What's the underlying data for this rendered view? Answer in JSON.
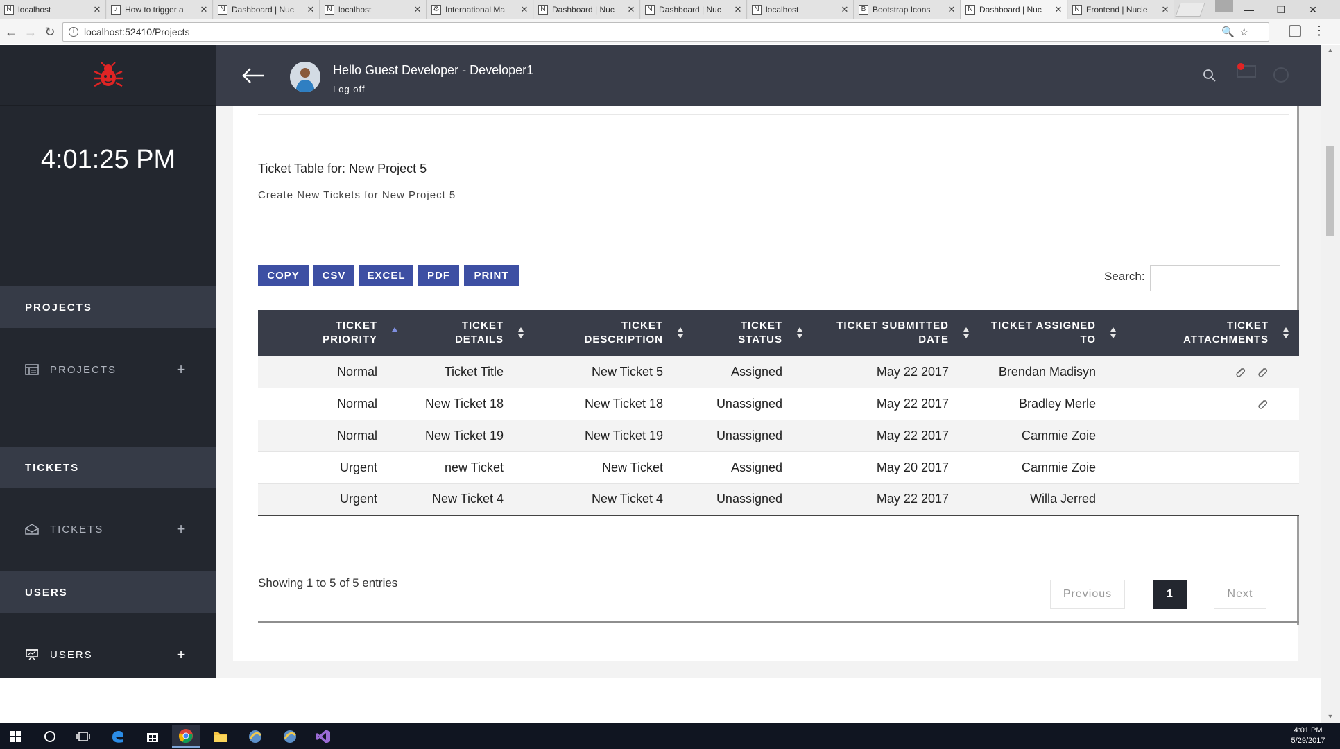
{
  "browser": {
    "tabs": [
      {
        "icon": "N",
        "title": "localhost"
      },
      {
        "icon": "♪",
        "title": "How to trigger a"
      },
      {
        "icon": "N",
        "title": "Dashboard | Nuc"
      },
      {
        "icon": "N",
        "title": "localhost"
      },
      {
        "icon": "⚙",
        "title": "International Ma"
      },
      {
        "icon": "N",
        "title": "Dashboard | Nuc"
      },
      {
        "icon": "N",
        "title": "Dashboard | Nuc"
      },
      {
        "icon": "N",
        "title": "localhost"
      },
      {
        "icon": "B",
        "title": "Bootstrap Icons"
      },
      {
        "icon": "N",
        "title": "Dashboard | Nuc"
      },
      {
        "icon": "N",
        "title": "Frontend | Nucle"
      }
    ],
    "active_tab_index": 9,
    "url": "localhost:52410/Projects"
  },
  "sidebar": {
    "clock": "4:01:25 PM",
    "sections": [
      {
        "header": "PROJECTS",
        "item": "PROJECTS"
      },
      {
        "header": "TICKETS",
        "item": "TICKETS"
      },
      {
        "header": "USERS",
        "item": "USERS"
      }
    ]
  },
  "topbar": {
    "greeting": "Hello Guest Developer  - Developer1",
    "logoff": "Log off"
  },
  "main": {
    "title": "Ticket Table for: New Project 5",
    "subtitle": "Create New Tickets for New Project 5",
    "export_buttons": [
      "COPY",
      "CSV",
      "EXCEL",
      "PDF",
      "PRINT"
    ],
    "search_label": "Search:",
    "search_value": "",
    "table": {
      "headers": [
        [
          "TICKET",
          "PRIORITY"
        ],
        [
          "TICKET",
          "DETAILS"
        ],
        [
          "TICKET",
          "DESCRIPTION"
        ],
        [
          "TICKET",
          "STATUS"
        ],
        [
          "TICKET SUBMITTED",
          "DATE"
        ],
        [
          "TICKET ASSIGNED",
          "TO"
        ],
        [
          "TICKET",
          "ATTACHMENTS"
        ]
      ],
      "rows": [
        {
          "priority": "Normal",
          "details": "Ticket Title",
          "description": "New Ticket 5",
          "status": "Assigned",
          "date": "May 22 2017",
          "assigned": "Brendan Madisyn",
          "attachments": 2
        },
        {
          "priority": "Normal",
          "details": "New Ticket 18",
          "description": "New Ticket 18",
          "status": "Unassigned",
          "date": "May 22 2017",
          "assigned": "Bradley Merle",
          "attachments": 1
        },
        {
          "priority": "Normal",
          "details": "New Ticket 19",
          "description": "New Ticket 19",
          "status": "Unassigned",
          "date": "May 22 2017",
          "assigned": "Cammie Zoie",
          "attachments": 0
        },
        {
          "priority": "Urgent",
          "details": "new Ticket",
          "description": "New Ticket",
          "status": "Assigned",
          "date": "May 20 2017",
          "assigned": "Cammie Zoie",
          "attachments": 0
        },
        {
          "priority": "Urgent",
          "details": "New Ticket 4",
          "description": "New Ticket 4",
          "status": "Unassigned",
          "date": "May 22 2017",
          "assigned": "Willa Jerred",
          "attachments": 0
        }
      ]
    },
    "showing": "Showing 1 to 5 of 5 entries",
    "pagination": {
      "previous": "Previous",
      "current": "1",
      "next": "Next"
    }
  },
  "taskbar": {
    "time": "4:01 PM",
    "date": "5/29/2017"
  },
  "colors": {
    "sidebar_bg": "#23272f",
    "topbar_bg": "#393d49",
    "button_blue": "#3d4fa3",
    "urgent_red": "#d62728",
    "logo_red": "#e02424"
  }
}
